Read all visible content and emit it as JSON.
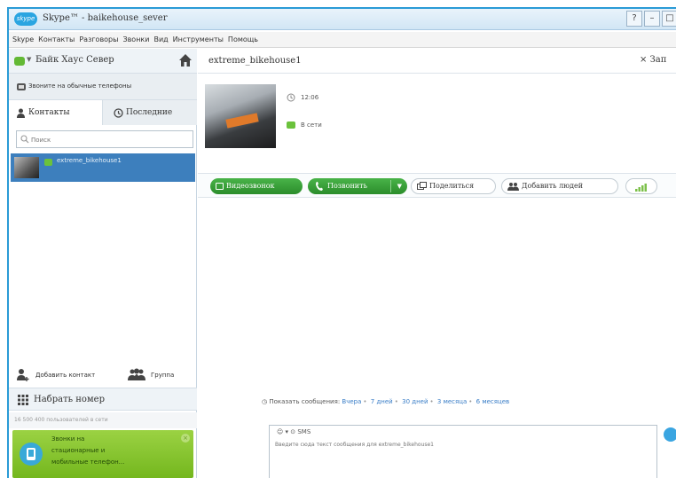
{
  "window": {
    "title": "Skype™ - baikehouse_sever",
    "logo": "skype"
  },
  "menu": [
    "Skype",
    "Контакты",
    "Разговоры",
    "Звонки",
    "Вид",
    "Инструменты",
    "Помощь"
  ],
  "sidebar": {
    "profile_name": "Байк Хаус Север",
    "call_phones": "Звоните на обычные телефоны",
    "tabs": {
      "contacts": "Контакты",
      "recent": "Последние"
    },
    "search_placeholder": "Поиск",
    "contacts": [
      {
        "name": "extreme_bikehouse1"
      }
    ],
    "add_contact": "Добавить контакт",
    "group": "Группа",
    "dial": "Набрать номер",
    "online_count": "16 500 400 пользователей в сети",
    "promo": {
      "line1": "Звонки на",
      "line2": "стационарные и",
      "line3": "мобильные телефон..."
    }
  },
  "conversation": {
    "title": "extreme_bikehouse1",
    "close": "× Зап",
    "local_time": "12:06",
    "status": "В сети",
    "buttons": {
      "video": "Видеозвонок",
      "call": "Позвонить",
      "share": "Поделиться",
      "add_people": "Добавить людей"
    },
    "history": {
      "label": "Показать сообщения:",
      "options": [
        "Вчера",
        "7 дней",
        "30 дней",
        "3 месяца",
        "6 месяцев"
      ]
    },
    "compose": {
      "toolbar": "☺ ▾  ⊙ SMS",
      "placeholder": "Введите сюда текст сообщения для extreme_bikehouse1"
    }
  },
  "colors": {
    "accent": "#2a9bd6",
    "selected": "#3d7fbd",
    "green": "#2b8d2b",
    "promo": "#8cc63e"
  }
}
